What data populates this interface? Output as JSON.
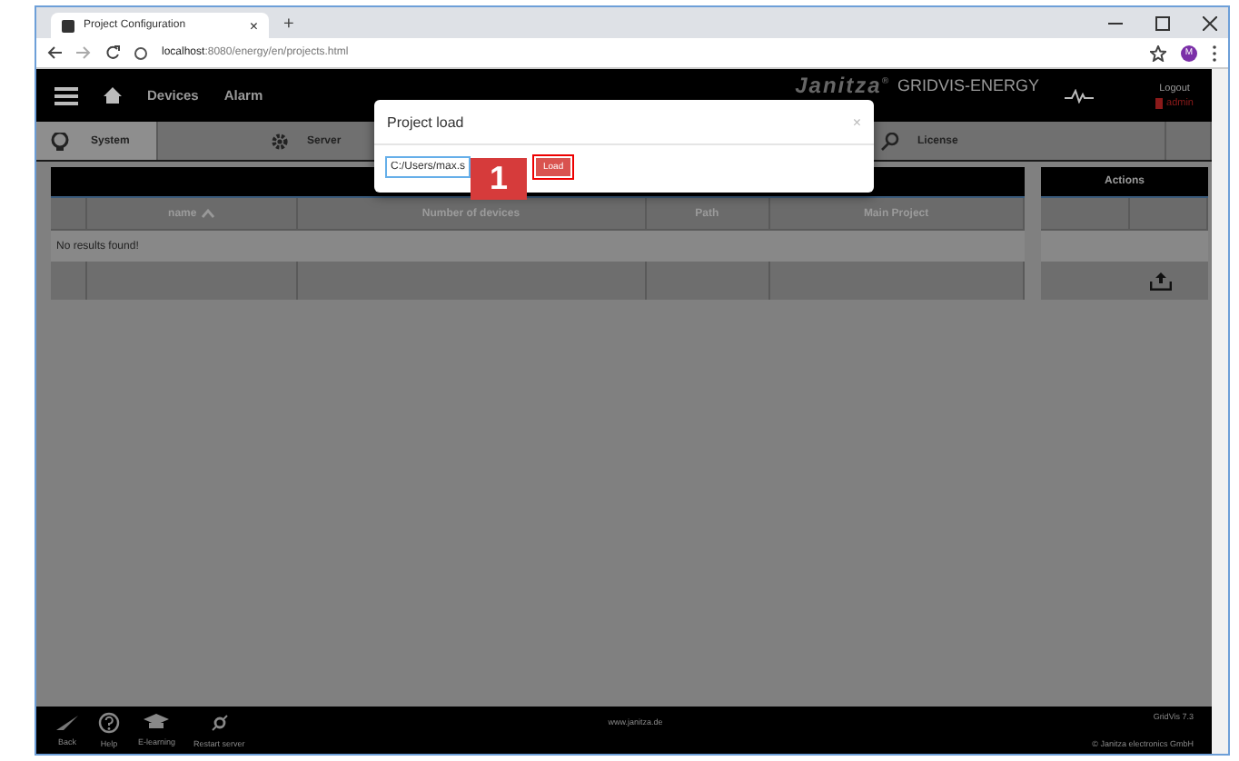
{
  "browser": {
    "tab_title": "Project Configuration",
    "tab_close": "×",
    "new_tab": "+",
    "url_host": "localhost",
    "url_rest": ":8080/energy/en/projects.html",
    "profile": "M"
  },
  "header": {
    "nav": [
      "Devices",
      "Alarm"
    ],
    "logo": "Janitza",
    "logo_mark": "®",
    "product": "GRIDVIS-ENERGY",
    "logout": "Logout",
    "user": "admin"
  },
  "subnav": [
    {
      "label": "System",
      "kind": "system",
      "selected": true
    },
    {
      "label": "Server",
      "kind": "server",
      "selected": false
    },
    {
      "label": "License",
      "kind": "license",
      "selected": false
    }
  ],
  "table": {
    "columns": [
      {
        "sorted": false
      },
      {
        "label": "name",
        "sorted": true
      },
      {
        "label": "Number of devices",
        "sorted": false
      },
      {
        "label": "Path",
        "sorted": false
      },
      {
        "label": "Main Project",
        "sorted": false
      }
    ],
    "empty_message": "No results found!"
  },
  "actions": {
    "title": "Actions"
  },
  "dialog": {
    "title": "Project load",
    "close": "×",
    "value": "C:/Users/max.s",
    "button": "Load"
  },
  "callout": "1",
  "footer": {
    "items": [
      {
        "label": "Back",
        "kind": "back"
      },
      {
        "label": "Help",
        "kind": "help"
      },
      {
        "label": "E-learning",
        "kind": "learning"
      },
      {
        "label": "Restart server",
        "kind": "restart"
      }
    ],
    "website": "www.janitza.de",
    "version": "GridVis 7.3",
    "copyright": "© Janitza electronics GmbH"
  }
}
